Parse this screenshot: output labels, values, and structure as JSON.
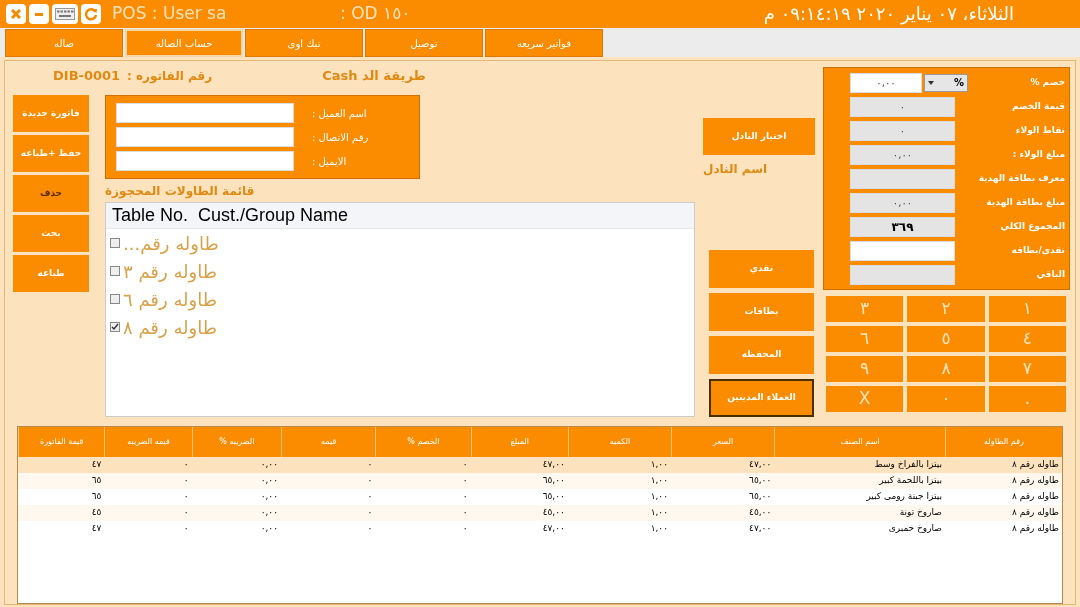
{
  "title_bar": {
    "user": "POS : User sa",
    "order": ": OD ١٥٠",
    "datetime": "الثلاثاء، ٠٧ يناير ٢٠٢٠ ٠٩:١٤:١٩ م"
  },
  "tabs": [
    {
      "label": "فواتير سريعه",
      "selected": false
    },
    {
      "label": "توصيل",
      "selected": false
    },
    {
      "label": "تيك اوى",
      "selected": false
    },
    {
      "label": "حساب الصاله",
      "selected": true
    },
    {
      "label": "صاله",
      "selected": false
    }
  ],
  "invoice": {
    "number": "DIB-0001",
    "number_label": "رقم الفاتوره :",
    "payment_method": "طريقة الد Cash"
  },
  "actions": [
    {
      "label": "فاتورة جديدة",
      "selected": false
    },
    {
      "label": "حفظ +طباعه",
      "selected": false
    },
    {
      "label": "حذف",
      "selected": true
    },
    {
      "label": "بحث",
      "selected": false
    },
    {
      "label": "طباعه",
      "selected": false
    }
  ],
  "customer_fields": [
    {
      "label": "اسم العميل :"
    },
    {
      "label": "رقم الاتصال :"
    },
    {
      "label": "الايميل :"
    }
  ],
  "reserved_tables": {
    "title": "قائمة الطاولات المحجوزة",
    "columns": [
      "Cust./Group Name",
      "Table No."
    ],
    "items": [
      {
        "label": "طاوله رقم...",
        "checked": false
      },
      {
        "label": "طاوله رقم ٣",
        "checked": false
      },
      {
        "label": "طاوله رقم ٦",
        "checked": false
      },
      {
        "label": "طاوله رقم ٨",
        "checked": true
      }
    ]
  },
  "waiter": {
    "button": "اختيار النادل",
    "label": "اسم النادل"
  },
  "payment_buttons": [
    {
      "label": "نقدي",
      "selected": false
    },
    {
      "label": "بطاقات",
      "selected": false
    },
    {
      "label": "المحفظه",
      "selected": false
    },
    {
      "label": "العملاء المدينين",
      "selected": true
    }
  ],
  "totals": [
    {
      "kind": "discount",
      "label": "خصم %",
      "value": "٠,٠٠",
      "unit": "%",
      "editable": true
    },
    {
      "kind": "field",
      "label": "قيمة الخصم",
      "value": "٠",
      "editable": false
    },
    {
      "kind": "field",
      "label": "نقاط الولاء",
      "value": "٠",
      "editable": false
    },
    {
      "kind": "field",
      "label": "مبلغ الولاء :",
      "value": "٠,٠٠",
      "editable": false
    },
    {
      "kind": "field",
      "label": "معرف بطاقة الهدية",
      "editable": false
    },
    {
      "kind": "field",
      "label": "مبلغ بطاقة الهدية",
      "value": "٠,٠٠",
      "editable": false
    },
    {
      "kind": "total",
      "label": "المجموع الكلي",
      "value": "٣٦٩",
      "editable": false
    },
    {
      "kind": "field",
      "label": "نقدى/بطاقه",
      "editable": true
    },
    {
      "kind": "field",
      "label": "الباقي",
      "editable": false
    }
  ],
  "keypad": [
    [
      "١",
      "٢",
      "٣"
    ],
    [
      "٤",
      "٥",
      "٦"
    ],
    [
      "٧",
      "٨",
      "٩"
    ],
    [
      ".",
      "٠",
      "X"
    ]
  ],
  "items_table": {
    "columns": [
      "رقم الطاوله",
      "اسم الصنف",
      "السعر",
      "الكميه",
      "المبلغ",
      "الخصم %",
      "قيمه",
      "الضريبه %",
      "قيمه الضريبه",
      "قيمة الفاتورة"
    ],
    "rows": [
      {
        "selected": true,
        "cells": [
          "طاوله رقم ٨",
          "بيتزا بالفراخ وسط",
          "٤٧,٠٠",
          "١,٠٠",
          "٤٧,٠٠",
          "٠",
          "٠",
          "٠,٠٠",
          "٠",
          "٤٧"
        ]
      },
      {
        "selected": false,
        "cells": [
          "طاوله رقم ٨",
          "بيتزا باللحمة كبير",
          "٦٥,٠٠",
          "١,٠٠",
          "٦٥,٠٠",
          "٠",
          "٠",
          "٠,٠٠",
          "٠",
          "٦٥"
        ]
      },
      {
        "selected": false,
        "cells": [
          "طاوله رقم ٨",
          "بيتزا جبنة رومى كبير",
          "٦٥,٠٠",
          "١,٠٠",
          "٦٥,٠٠",
          "٠",
          "٠",
          "٠,٠٠",
          "٠",
          "٦٥"
        ]
      },
      {
        "selected": false,
        "cells": [
          "طاوله رقم ٨",
          "صاروخ تونة",
          "٤٥,٠٠",
          "١,٠٠",
          "٤٥,٠٠",
          "٠",
          "٠",
          "٠,٠٠",
          "٠",
          "٤٥"
        ]
      },
      {
        "selected": false,
        "cells": [
          "طاوله رقم ٨",
          "صاروخ حمبرى",
          "٤٧,٠٠",
          "١,٠٠",
          "٤٧,٠٠",
          "٠",
          "٠",
          "٠,٠٠",
          "٠",
          "٤٧"
        ]
      }
    ]
  }
}
